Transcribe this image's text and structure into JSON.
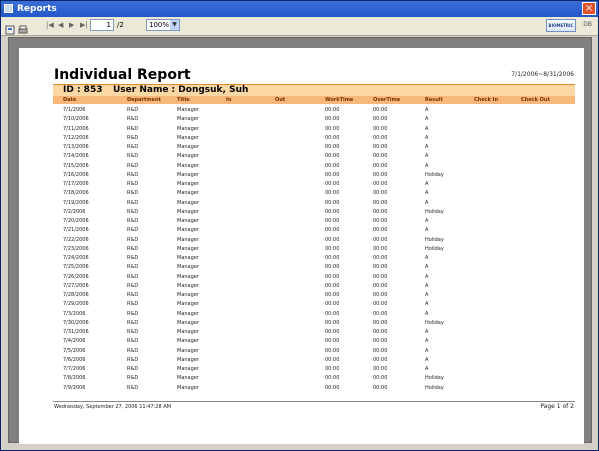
{
  "window": {
    "title": "Reports",
    "close": "×"
  },
  "toolbar": {
    "page_current": "1",
    "page_total": "/2",
    "zoom": "100%",
    "brand": "BIOMETRIC",
    "right_label": "DB"
  },
  "report": {
    "title": "Individual Report",
    "date_range": "7/1/2006~8/31/2006",
    "id_label": "ID : 853",
    "user_label": "User Name : Dongsuk, Suh",
    "columns": [
      "Date",
      "Department",
      "Title",
      "In",
      "Out",
      "WorkTime",
      "OverTime",
      "Result",
      "Check In",
      "Check Out"
    ],
    "rows": [
      [
        "7/1/2006",
        "R&D",
        "Manager",
        "",
        "",
        "00:00",
        "00:00",
        "A",
        "",
        ""
      ],
      [
        "7/10/2006",
        "R&D",
        "Manager",
        "",
        "",
        "00:00",
        "00:00",
        "A",
        "",
        ""
      ],
      [
        "7/11/2006",
        "R&D",
        "Manager",
        "",
        "",
        "00:00",
        "00:00",
        "A",
        "",
        ""
      ],
      [
        "7/12/2006",
        "R&D",
        "Manager",
        "",
        "",
        "00:00",
        "00:00",
        "A",
        "",
        ""
      ],
      [
        "7/13/2006",
        "R&D",
        "Manager",
        "",
        "",
        "00:00",
        "00:00",
        "A",
        "",
        ""
      ],
      [
        "7/14/2006",
        "R&D",
        "Manager",
        "",
        "",
        "00:00",
        "00:00",
        "A",
        "",
        ""
      ],
      [
        "7/15/2006",
        "R&D",
        "Manager",
        "",
        "",
        "00:00",
        "00:00",
        "A",
        "",
        ""
      ],
      [
        "7/16/2006",
        "R&D",
        "Manager",
        "",
        "",
        "00:00",
        "00:00",
        "Holiday",
        "",
        ""
      ],
      [
        "7/17/2006",
        "R&D",
        "Manager",
        "",
        "",
        "00:00",
        "00:00",
        "A",
        "",
        ""
      ],
      [
        "7/18/2006",
        "R&D",
        "Manager",
        "",
        "",
        "00:00",
        "00:00",
        "A",
        "",
        ""
      ],
      [
        "7/19/2006",
        "R&D",
        "Manager",
        "",
        "",
        "00:00",
        "00:00",
        "A",
        "",
        ""
      ],
      [
        "7/2/2006",
        "R&D",
        "Manager",
        "",
        "",
        "00:00",
        "00:00",
        "Holiday",
        "",
        ""
      ],
      [
        "7/20/2006",
        "R&D",
        "Manager",
        "",
        "",
        "00:00",
        "00:00",
        "A",
        "",
        ""
      ],
      [
        "7/21/2006",
        "R&D",
        "Manager",
        "",
        "",
        "00:00",
        "00:00",
        "A",
        "",
        ""
      ],
      [
        "7/22/2006",
        "R&D",
        "Manager",
        "",
        "",
        "00:00",
        "00:00",
        "Holiday",
        "",
        ""
      ],
      [
        "7/23/2006",
        "R&D",
        "Manager",
        "",
        "",
        "00:00",
        "00:00",
        "Holiday",
        "",
        ""
      ],
      [
        "7/24/2006",
        "R&D",
        "Manager",
        "",
        "",
        "00:00",
        "00:00",
        "A",
        "",
        ""
      ],
      [
        "7/25/2006",
        "R&D",
        "Manager",
        "",
        "",
        "00:00",
        "00:00",
        "A",
        "",
        ""
      ],
      [
        "7/26/2006",
        "R&D",
        "Manager",
        "",
        "",
        "00:00",
        "00:00",
        "A",
        "",
        ""
      ],
      [
        "7/27/2006",
        "R&D",
        "Manager",
        "",
        "",
        "00:00",
        "00:00",
        "A",
        "",
        ""
      ],
      [
        "7/28/2006",
        "R&D",
        "Manager",
        "",
        "",
        "00:00",
        "00:00",
        "A",
        "",
        ""
      ],
      [
        "7/29/2006",
        "R&D",
        "Manager",
        "",
        "",
        "00:00",
        "00:00",
        "A",
        "",
        ""
      ],
      [
        "7/3/2006",
        "R&D",
        "Manager",
        "",
        "",
        "00:00",
        "00:00",
        "A",
        "",
        ""
      ],
      [
        "7/30/2006",
        "R&D",
        "Manager",
        "",
        "",
        "00:00",
        "00:00",
        "Holiday",
        "",
        ""
      ],
      [
        "7/31/2006",
        "R&D",
        "Manager",
        "",
        "",
        "00:00",
        "00:00",
        "A",
        "",
        ""
      ],
      [
        "7/4/2006",
        "R&D",
        "Manager",
        "",
        "",
        "00:00",
        "00:00",
        "A",
        "",
        ""
      ],
      [
        "7/5/2006",
        "R&D",
        "Manager",
        "",
        "",
        "00:00",
        "00:00",
        "A",
        "",
        ""
      ],
      [
        "7/6/2006",
        "R&D",
        "Manager",
        "",
        "",
        "00:00",
        "00:00",
        "A",
        "",
        ""
      ],
      [
        "7/7/2006",
        "R&D",
        "Manager",
        "",
        "",
        "00:00",
        "00:00",
        "A",
        "",
        ""
      ],
      [
        "7/8/2006",
        "R&D",
        "Manager",
        "",
        "",
        "00:00",
        "00:00",
        "Holiday",
        "",
        ""
      ],
      [
        "7/9/2006",
        "R&D",
        "Manager",
        "",
        "",
        "00:00",
        "00:00",
        "Holiday",
        "",
        ""
      ]
    ],
    "footer_left": "Wednesday, September 27, 2006 11:47:28 AM",
    "footer_right": "Page 1 of 2"
  },
  "colors": {
    "title_bar": "#2457c9",
    "id_bar": "#fad7a3",
    "header_bar": "#f7b97a",
    "viewer_bg": "#808080"
  }
}
